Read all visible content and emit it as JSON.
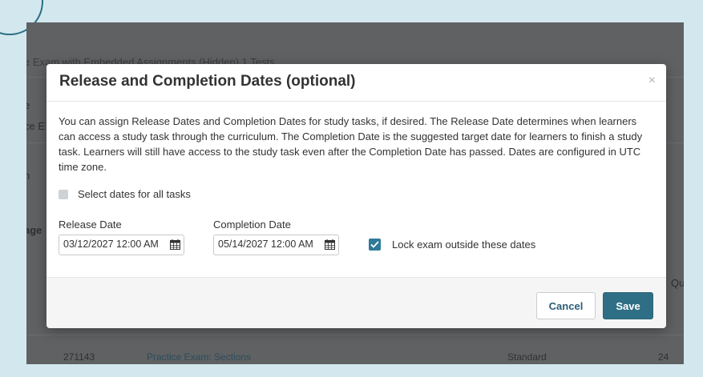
{
  "background": {
    "breadcrumb": "e Exam with Embedded Assignments (Hidden) 1 Tests",
    "left_fragment_1": "e",
    "left_fragment_2": "ce E",
    "left_fragment_3": "h",
    "left_fragment_4": "age",
    "right_fragment": "Que",
    "row": {
      "id": "271143",
      "name": "Practice Exam: Sections",
      "type": "Standard",
      "count": "24"
    }
  },
  "modal": {
    "title": "Release and Completion Dates (optional)",
    "close_glyph": "×",
    "description": "You can assign Release Dates and Completion Dates for study tasks, if desired. The Release Date determines when learners can access a study task through the curriculum. The Completion Date is the suggested target date for learners to finish a study task. Learners will still have access to the study task even after the Completion Date has passed. Dates are configured in UTC time zone.",
    "select_all_label": "Select dates for all tasks",
    "release_date": {
      "label": "Release Date",
      "value": "03/12/2027 12:00 AM"
    },
    "completion_date": {
      "label": "Completion Date",
      "value": "05/14/2027 12:00 AM"
    },
    "lock_exam_label": "Lock exam outside these dates",
    "lock_exam_checked": true,
    "cancel_label": "Cancel",
    "save_label": "Save"
  },
  "colors": {
    "accent": "#2f6f86",
    "overlay": "#5f6163",
    "page_bg": "#d3e8ee"
  }
}
